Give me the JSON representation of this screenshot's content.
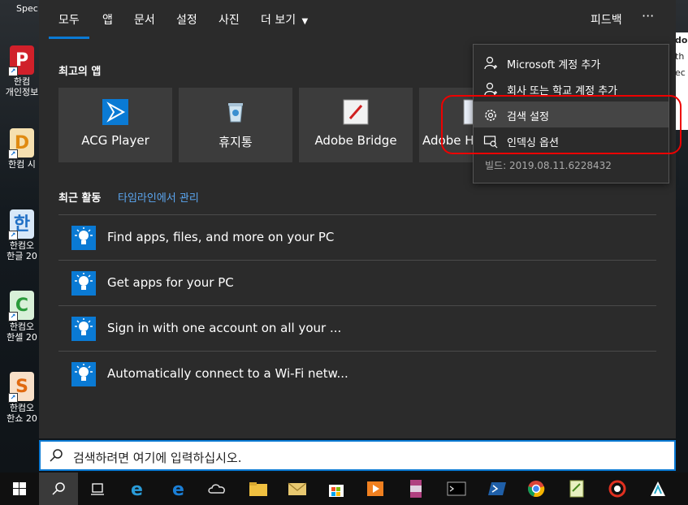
{
  "desktop": {
    "top_label": "Spec",
    "icons": [
      {
        "label_line1": "한컴",
        "label_line2": "개인정보",
        "color": "#d0202a",
        "glyph": "P"
      },
      {
        "label_line1": "한컴 시",
        "label_line2": "",
        "color": "#e08a10",
        "glyph": "D"
      },
      {
        "label_line1": "한컴오",
        "label_line2": "한글 20",
        "color": "#1f6fc5",
        "glyph": "한"
      },
      {
        "label_line1": "한컴오",
        "label_line2": "한셀 20",
        "color": "#2a9a3a",
        "glyph": "C"
      },
      {
        "label_line1": "한컴오",
        "label_line2": "한쇼 20",
        "color": "#e06a10",
        "glyph": "S"
      }
    ],
    "right_doc_lines": [
      "do",
      "th",
      "ec"
    ]
  },
  "tabs": [
    {
      "label": "모두",
      "active": true
    },
    {
      "label": "앱"
    },
    {
      "label": "문서"
    },
    {
      "label": "설정"
    },
    {
      "label": "사진"
    },
    {
      "label": "더 보기"
    }
  ],
  "header": {
    "feedback_label": "피드백",
    "more_label": "···"
  },
  "recent_apps": {
    "title": "최고의 앱",
    "apps": [
      {
        "label": "ACG Player",
        "icon": "acg-player-icon"
      },
      {
        "label": "휴지통",
        "icon": "recycle-bin-icon"
      },
      {
        "label": "Adobe Bridge",
        "icon": "adobe-bridge-icon"
      },
      {
        "label": "Adobe H",
        "icon": "adobe-h-icon"
      }
    ]
  },
  "recent_activity": {
    "title": "최근 활동",
    "timeline_link": "타임라인에서 관리",
    "items": [
      {
        "label": "Find apps, files, and more on your PC"
      },
      {
        "label": "Get apps for your PC"
      },
      {
        "label": "Sign in with one account on all your ..."
      },
      {
        "label": "Automatically connect to a Wi-Fi netw..."
      }
    ]
  },
  "menu": {
    "items": [
      {
        "label": "Microsoft 계정 추가",
        "icon": "person-add-icon"
      },
      {
        "label": "회사 또는 학교 계정 추가",
        "icon": "person-add-icon"
      },
      {
        "label": "검색 설정",
        "icon": "gear-icon",
        "highlighted": true
      },
      {
        "label": "인덱싱 옵션",
        "icon": "indexing-icon"
      }
    ],
    "build": "빌드: 2019.08.11.6228432"
  },
  "search": {
    "placeholder": "검색하려면 여기에 입력하십시오."
  },
  "taskbar": {
    "items": [
      "windows-start-icon",
      "search-icon",
      "task-view-icon",
      "internet-explorer-icon",
      "edge-icon",
      "onedrive-icon",
      "file-explorer-icon",
      "mail-icon",
      "store-icon",
      "media-player-icon",
      "winrar-icon",
      "cmd-icon",
      "powershell-icon",
      "chrome-icon",
      "notepad-icon",
      "app-icon",
      "whale-icon"
    ]
  },
  "colors": {
    "accent": "#0a7ad4",
    "panel": "#2b2b2b",
    "tile": "#3c3c3c",
    "annotation_red": "#e00000"
  }
}
